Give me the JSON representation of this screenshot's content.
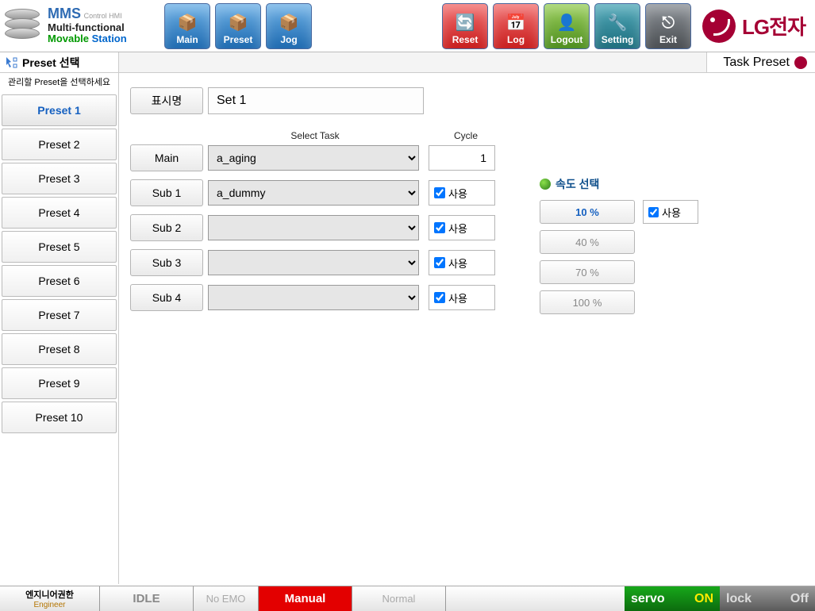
{
  "app": {
    "name": "MMS",
    "subtitle": "Control HMI",
    "line2": "Multi-functional",
    "line3a": "Movable",
    "line3b": "Station"
  },
  "toolbar": {
    "main": "Main",
    "preset": "Preset",
    "jog": "Jog",
    "reset": "Reset",
    "log": "Log",
    "logout": "Logout",
    "setting": "Setting",
    "exit": "Exit"
  },
  "brand": "LG전자",
  "crumb": {
    "left": "Preset 선택",
    "right": "Task Preset"
  },
  "sidebar": {
    "caption": "관리할 Preset을 선택하세요",
    "items": [
      {
        "label": "Preset 1",
        "active": true
      },
      {
        "label": "Preset 2"
      },
      {
        "label": "Preset 3"
      },
      {
        "label": "Preset 4"
      },
      {
        "label": "Preset 5"
      },
      {
        "label": "Preset 6"
      },
      {
        "label": "Preset 7"
      },
      {
        "label": "Preset 8"
      },
      {
        "label": "Preset 9"
      },
      {
        "label": "Preset 10"
      }
    ]
  },
  "form": {
    "display_name_label": "표시명",
    "display_name_value": "Set 1",
    "header_task": "Select Task",
    "header_cycle": "Cycle",
    "use_label": "사용",
    "rows": [
      {
        "label": "Main",
        "task": "a_aging",
        "cycle": "1",
        "has_cycle": true,
        "has_use": false
      },
      {
        "label": "Sub 1",
        "task": "a_dummy",
        "has_use": true
      },
      {
        "label": "Sub 2",
        "task": "",
        "has_use": true
      },
      {
        "label": "Sub 3",
        "task": "",
        "has_use": true
      },
      {
        "label": "Sub 4",
        "task": "",
        "has_use": true
      }
    ]
  },
  "speed": {
    "title": "속도 선택",
    "use_label": "사용",
    "options": [
      {
        "label": "10 %",
        "active": true
      },
      {
        "label": "40 %"
      },
      {
        "label": "70 %"
      },
      {
        "label": "100 %"
      }
    ]
  },
  "status": {
    "auth_title": "엔지니어권한",
    "auth_sub": "Engineer",
    "idle": "IDLE",
    "noemo": "No EMO",
    "manual": "Manual",
    "normal": "Normal",
    "servo_label": "servo",
    "servo_state": "ON",
    "lock_label": "lock",
    "lock_state": "Off"
  }
}
